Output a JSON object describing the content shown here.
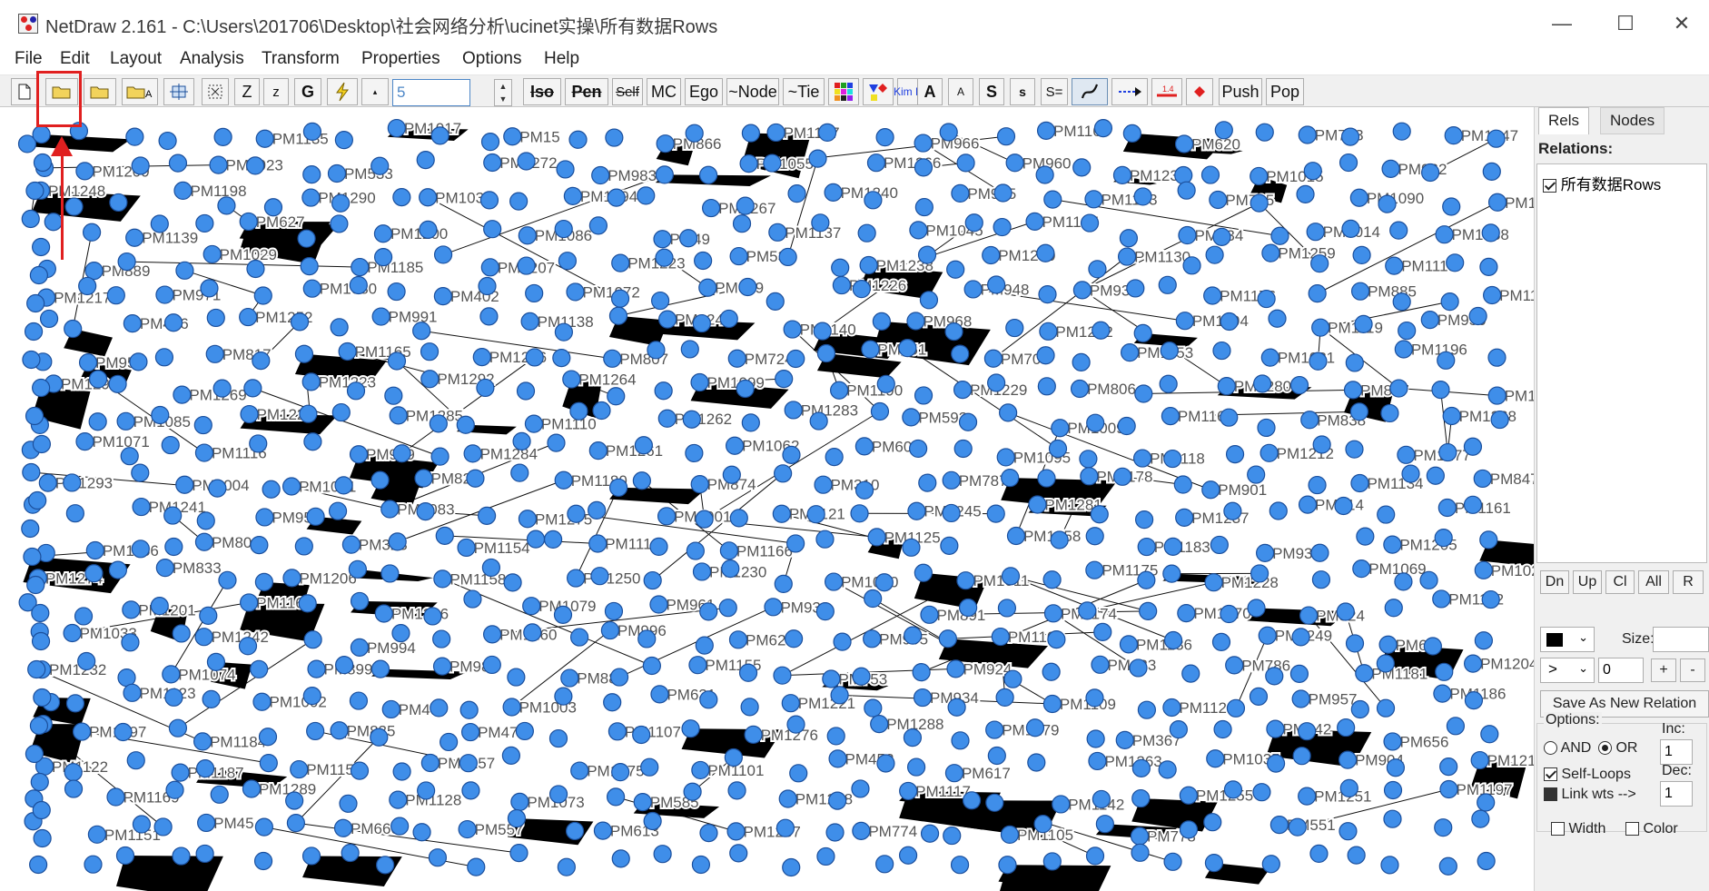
{
  "window": {
    "title": "NetDraw 2.161 - C:\\Users\\201706\\Desktop\\社会网络分析\\ucinet实操\\所有数据Rows",
    "minimize": "—",
    "maximize": "☐",
    "close": "✕"
  },
  "menu": [
    "File",
    "Edit",
    "Layout",
    "Analysis",
    "Transform",
    "Properties",
    "Options",
    "Help"
  ],
  "toolbar": {
    "z_upper": "Z",
    "z_lower": "z",
    "g": "G",
    "number_value": "5",
    "iso": "Iso",
    "pen": "Pen",
    "self": "Self",
    "mc": "MC",
    "ego": "Ego",
    "node": "~Node",
    "tie": "~Tie",
    "kim_bill": "Kim Bill",
    "a_upper": "A",
    "a_lower": "A",
    "s_upper": "S",
    "s_lower": "s",
    "s_eq": "S=",
    "push": "Push",
    "pop": "Pop"
  },
  "panel": {
    "tabs": [
      "Rels",
      "Nodes"
    ],
    "relations_label": "Relations:",
    "relation_item": "所有数据Rows",
    "buttons": [
      "Dn",
      "Up",
      "Cl",
      "All",
      "R"
    ],
    "size_label": "Size:",
    "operator": ">",
    "threshold": "0",
    "plus": "+",
    "minus": "-",
    "save_relation": "Save As New Relation",
    "options_label": "Options:",
    "and_label": "AND",
    "or_label": "OR",
    "inc_label": "Inc:",
    "inc_value": "1",
    "dec_label": "Dec:",
    "dec_value": "1",
    "self_loops": "Self-Loops",
    "link_wts": "Link wts -->",
    "width_label": "Width",
    "color_label": "Color"
  },
  "colors": {
    "node_fill": "#3f8ee9",
    "node_stroke": "#1b4f9c",
    "highlight": "#e02020"
  },
  "graph": {
    "labels": [
      "PM1135",
      "PM1017",
      "PM15",
      "PM866",
      "PM1157",
      "PM966",
      "PM1164",
      "PM620",
      "PM783",
      "PM1047",
      "PM1209",
      "PM1023",
      "PM533",
      "PM1272",
      "PM983",
      "PM1055",
      "PM1266",
      "PM960",
      "PM1233",
      "PM1015",
      "PM962",
      "PM1248",
      "PM1198",
      "PM1290",
      "PM1031",
      "PM1294",
      "PM1267",
      "PM1240",
      "PM975",
      "PM1193",
      "PM705",
      "PM1090",
      "PM1133",
      "PM1139",
      "PM627",
      "PM1200",
      "PM1086",
      "PM49",
      "PM1137",
      "PM1045",
      "PM1147",
      "PM234",
      "PM1014",
      "PM1088",
      "PM889",
      "PM1029",
      "PM1185",
      "PM1207",
      "PM1223",
      "PM532",
      "PM1238",
      "PM1239",
      "PM1130",
      "PM1259",
      "PM1113",
      "PM1217",
      "PM971",
      "PM1080",
      "PM402",
      "PM1072",
      "PM699",
      "PM1226",
      "PM948",
      "PM930",
      "PM1176",
      "PM885",
      "PM1163",
      "PM486",
      "PM1252",
      "PM991",
      "PM1138",
      "PM1247",
      "PM1140",
      "PM968",
      "PM1282",
      "PM1194",
      "PM1119",
      "PM950",
      "PM958",
      "PM817",
      "PM1165",
      "PM1236",
      "PM807",
      "PM724",
      "PM951",
      "PM704",
      "PM1153",
      "PM1081",
      "PM1196",
      "PM1291",
      "PM1269",
      "PM1223",
      "PM1292",
      "PM1264",
      "PM1099",
      "PM1190",
      "PM1229",
      "PM806",
      "PM1280",
      "PM837",
      "PM1146",
      "PM1085",
      "PM1227",
      "PM1285",
      "PM1110",
      "PM1262",
      "PM1283",
      "PM593",
      "PM1009",
      "PM1162",
      "PM838",
      "PM1268",
      "PM1071",
      "PM1116",
      "PM949",
      "PM1284",
      "PM1261",
      "PM1062",
      "PM600",
      "PM1095",
      "PM1118",
      "PM1212",
      "PM1277",
      "PM1293",
      "PM1004",
      "PM1091",
      "PM827",
      "PM1180",
      "PM874",
      "PM310",
      "PM787",
      "PM1178",
      "PM901",
      "PM1134",
      "PM847",
      "PM1241",
      "PM956",
      "PM1083",
      "PM1275",
      "PM1001",
      "PM1121",
      "PM1245",
      "PM1281",
      "PM1237",
      "PM714",
      "PM1161",
      "PM1156",
      "PM801",
      "PM323",
      "PM1154",
      "PM1119",
      "PM1166",
      "PM1125",
      "PM1258",
      "PM1183",
      "PM938",
      "PM1205",
      "PM1274",
      "PM833",
      "PM1206",
      "PM1158",
      "PM1250",
      "PM1230",
      "PM1060",
      "PM1011",
      "PM1175",
      "PM1228",
      "PM1069",
      "PM1025",
      "PM1201",
      "PM1168",
      "PM1286",
      "PM1079",
      "PM961",
      "PM933",
      "PM891",
      "PM1174",
      "PM1270",
      "PM524",
      "PM1112",
      "PM1033",
      "PM1242",
      "PM994",
      "PM1260",
      "PM996",
      "PM626",
      "PM995",
      "PM1100",
      "PM1136",
      "PM1249",
      "PM62",
      "PM1232",
      "PM1074",
      "PM899",
      "PM989",
      "PM882",
      "PM1155",
      "PM753",
      "PM924",
      "PM423",
      "PM786",
      "PM1181",
      "PM1204",
      "PM1123",
      "PM1002",
      "PM490",
      "PM1003",
      "PM631",
      "PM1221",
      "PM934",
      "PM1109",
      "PM1129",
      "PM957",
      "PM1186",
      "PM1097",
      "PM1184",
      "PM835",
      "PM475",
      "PM1107",
      "PM1276",
      "PM1288",
      "PM1279",
      "PM367",
      "PM642",
      "PM656",
      "PM1122",
      "PM1187",
      "PM1150",
      "PM1257",
      "PM1075",
      "PM1101",
      "PM452",
      "PM617",
      "PM1263",
      "PM1035",
      "PM904",
      "PM1219",
      "PM1169",
      "PM1289",
      "PM1128",
      "PM1073",
      "PM585",
      "PM1278",
      "PM1117",
      "PM1142",
      "PM1255",
      "PM1251",
      "PM1197",
      "PM1151",
      "PM45",
      "PM660",
      "PM557",
      "PM613",
      "PM1287",
      "PM774",
      "PM1105",
      "PM778",
      "PM551"
    ]
  }
}
